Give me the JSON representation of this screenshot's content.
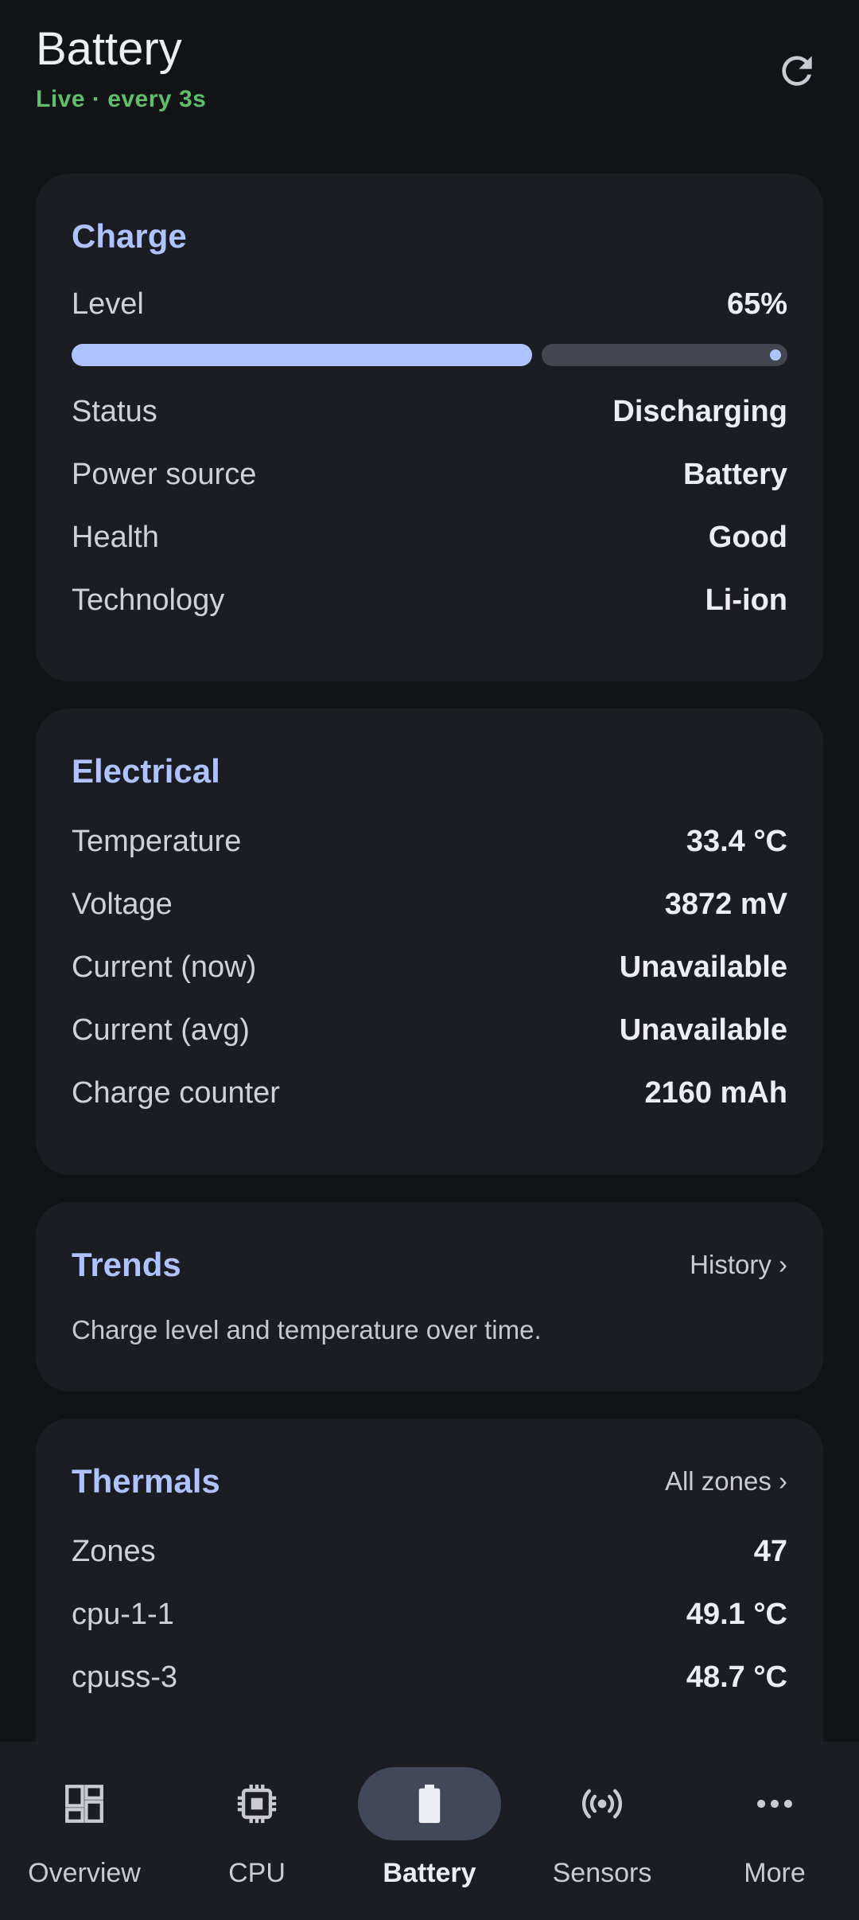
{
  "header": {
    "title": "Battery",
    "subtitle": "Live · every 3s",
    "refresh_icon": "refresh-icon"
  },
  "charge": {
    "title": "Charge",
    "level_label": "Level",
    "level_value": "65%",
    "level_fraction": 0.65,
    "rows": [
      {
        "label": "Status",
        "value": "Discharging"
      },
      {
        "label": "Power source",
        "value": "Battery"
      },
      {
        "label": "Health",
        "value": "Good"
      },
      {
        "label": "Technology",
        "value": "Li-ion"
      }
    ]
  },
  "electrical": {
    "title": "Electrical",
    "rows": [
      {
        "label": "Temperature",
        "value": "33.4 °C"
      },
      {
        "label": "Voltage",
        "value": "3872 mV"
      },
      {
        "label": "Current (now)",
        "value": "Unavailable"
      },
      {
        "label": "Current (avg)",
        "value": "Unavailable"
      },
      {
        "label": "Charge counter",
        "value": "2160 mAh"
      }
    ]
  },
  "trends": {
    "title": "Trends",
    "link": "History ›",
    "description": "Charge level and temperature over time."
  },
  "thermals": {
    "title": "Thermals",
    "link": "All zones ›",
    "rows": [
      {
        "label": "Zones",
        "value": "47"
      },
      {
        "label": "cpu-1-1",
        "value": "49.1 °C"
      },
      {
        "label": "cpuss-3",
        "value": "48.7 °C"
      }
    ]
  },
  "nav": {
    "items": [
      {
        "label": "Overview",
        "icon": "dashboard-icon"
      },
      {
        "label": "CPU",
        "icon": "chip-icon"
      },
      {
        "label": "Battery",
        "icon": "battery-icon",
        "active": true
      },
      {
        "label": "Sensors",
        "icon": "sensors-icon"
      },
      {
        "label": "More",
        "icon": "more-icon"
      }
    ]
  },
  "colors": {
    "background": "#121317",
    "card": "#1c1d23",
    "accent": "#aec3ff",
    "live": "#5fbf6a"
  }
}
